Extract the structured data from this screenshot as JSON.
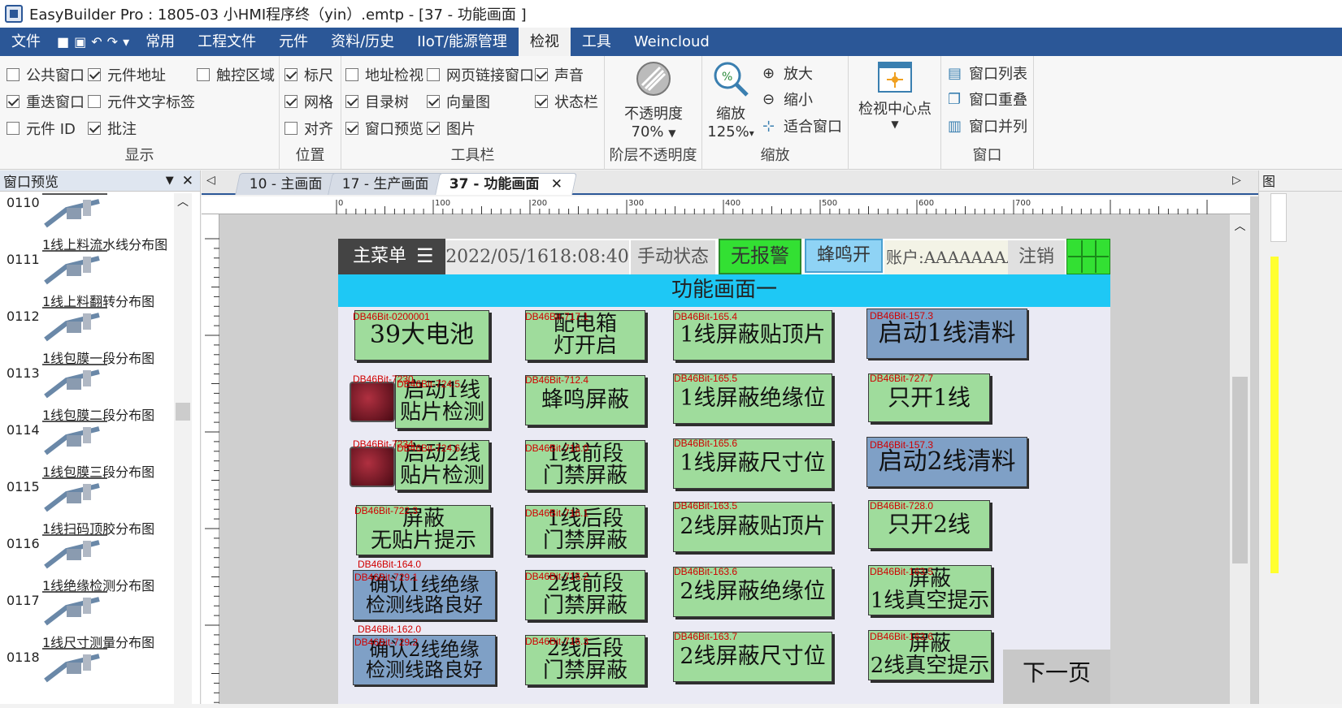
{
  "window": {
    "title": "EasyBuilder Pro : 1805-03 小HMI程序终（yin）.emtp - [37 - 功能画面 ]"
  },
  "menu": [
    "文件",
    "常用",
    "工程文件",
    "元件",
    "资料/历史",
    "IIoT/能源管理",
    "检视",
    "工具",
    "Weincloud"
  ],
  "menu_active": "检视",
  "ribbon": {
    "display": {
      "label": "显示",
      "items": [
        {
          "text": "公共窗口",
          "on": false
        },
        {
          "text": "元件地址",
          "on": true
        },
        {
          "text": "触控区域",
          "on": false
        },
        {
          "text": "重迭窗口",
          "on": true
        },
        {
          "text": "元件文字标签",
          "on": false
        },
        {
          "text": "元件 ID",
          "on": false
        },
        {
          "text": "批注",
          "on": true
        }
      ]
    },
    "position": {
      "label": "位置",
      "items": [
        {
          "text": "标尺",
          "on": true
        },
        {
          "text": "网格",
          "on": true
        },
        {
          "text": "对齐",
          "on": false
        }
      ]
    },
    "toolbar": {
      "label": "工具栏",
      "items": [
        {
          "text": "地址检视",
          "on": false
        },
        {
          "text": "网页链接窗口",
          "on": false
        },
        {
          "text": "声音",
          "on": true
        },
        {
          "text": "目录树",
          "on": true
        },
        {
          "text": "向量图",
          "on": true
        },
        {
          "text": "状态栏",
          "on": true
        },
        {
          "text": "窗口预览",
          "on": true
        },
        {
          "text": "图片",
          "on": true
        }
      ]
    },
    "opacity": {
      "label": "阶层不透明度",
      "btn": "不透明度",
      "value": "70%"
    },
    "zoom": {
      "label": "缩放",
      "btn": "缩放",
      "value": "125%",
      "zoom_in": "放大",
      "zoom_out": "缩小",
      "fit": "适合窗口"
    },
    "center": {
      "btn": "检视中心点"
    },
    "window": {
      "label": "窗口",
      "list": "窗口列表",
      "cascade": "窗口重叠",
      "tile": "窗口并列"
    }
  },
  "preview": {
    "title": "窗口预览",
    "items": [
      {
        "num": "0110",
        "cap": "1线上料流水线分布图"
      },
      {
        "num": "0111",
        "cap": "1线上料翻转分布图"
      },
      {
        "num": "0112",
        "cap": "1线包膜一段分布图"
      },
      {
        "num": "0113",
        "cap": "1线包膜二段分布图"
      },
      {
        "num": "0114",
        "cap": "1线包膜三段分布图"
      },
      {
        "num": "0115",
        "cap": "1线扫码顶胶分布图"
      },
      {
        "num": "0116",
        "cap": "1线绝缘检测分布图"
      },
      {
        "num": "0117",
        "cap": "1线尺寸测量分布图"
      },
      {
        "num": "0118",
        "cap": ""
      }
    ]
  },
  "tabs": [
    "10 - 主画面",
    "17 - 生产画面",
    "37 - 功能画面"
  ],
  "ruler": [
    "0",
    "100",
    "200",
    "300",
    "400",
    "500",
    "600",
    "700"
  ],
  "hmi": {
    "menu": "主菜单",
    "datetime": "2022/05/1618:08:40",
    "mode": "手动状态",
    "alarm": "无报警",
    "buzzer": "蜂鸣开",
    "account": "账户:AAAAAAAA",
    "logout": "注销",
    "page_title": "功能画面一",
    "next": "下一页",
    "tags": {
      "t1": "DB46Bit-0200001",
      "t2": "DB46Bit-717.1",
      "t3": "DB46Bit-165.4",
      "t4": "DB46Bit-157.3",
      "t5": "DB46Bit-724.5",
      "t6": "DB46Bit-712.4",
      "t7": "DB46Bit-165.5",
      "t8": "DB46Bit-727.7",
      "t9": "DB46Bit-724.6",
      "t10": "DB46Bit-716.0",
      "t11": "DB46Bit-165.6",
      "t12": "DB46Bit-157.3",
      "t13": "DB46Bit-722.3",
      "t14": "DB46Bit-716.1",
      "t15": "DB46Bit-163.5",
      "t16": "DB46Bit-728.0",
      "t17": "DB46Bit-164.0",
      "t18": "DB46Bit-729.1",
      "t19": "DB46Bit-716.2",
      "t20": "DB46Bit-163.6",
      "t21": "DB46Bit-163.5",
      "t22": "DB46Bit-162.0",
      "t23": "DB46Bit-729.2",
      "t24": "DB46Bit-716.3",
      "t25": "DB46Bit-163.7",
      "t26": "DB46Bit-163.6",
      "t27": "DB46Bit-7230",
      "t28": "DB46Bit-7234"
    },
    "buttons": {
      "b1": "39大电池",
      "b2": "配电箱\n灯开启",
      "b3": "1线屏蔽贴顶片",
      "b4": "启动1线清料",
      "b5": "启动1线\n贴片检测",
      "b6": "蜂鸣屏蔽",
      "b7": "1线屏蔽绝缘位",
      "b8": "只开1线",
      "b9": "启动2线\n贴片检测",
      "b10": "1线前段\n门禁屏蔽",
      "b11": "1线屏蔽尺寸位",
      "b12": "启动2线清料",
      "b13": "屏蔽\n无贴片提示",
      "b14": "1线后段\n门禁屏蔽",
      "b15": "2线屏蔽贴顶片",
      "b16": "只开2线",
      "b17": "确认1线绝缘\n检测线路良好",
      "b18": "2线前段\n门禁屏蔽",
      "b19": "2线屏蔽绝缘位",
      "b20": "屏蔽\n1线真空提示",
      "b21": "确认2线绝缘\n检测线路良好",
      "b22": "2线后段\n门禁屏蔽",
      "b23": "2线屏蔽尺寸位",
      "b24": "屏蔽\n2线真空提示"
    }
  },
  "colors": {
    "accent": "#2b5797",
    "title_bar_cyan": "#1ec8f5",
    "btn_green": "#9fdc9c",
    "btn_blue": "#7fa0c6",
    "alarm_green": "#33e033",
    "buzzer_blue": "#8fd3f5",
    "tag_red": "#d00000"
  }
}
